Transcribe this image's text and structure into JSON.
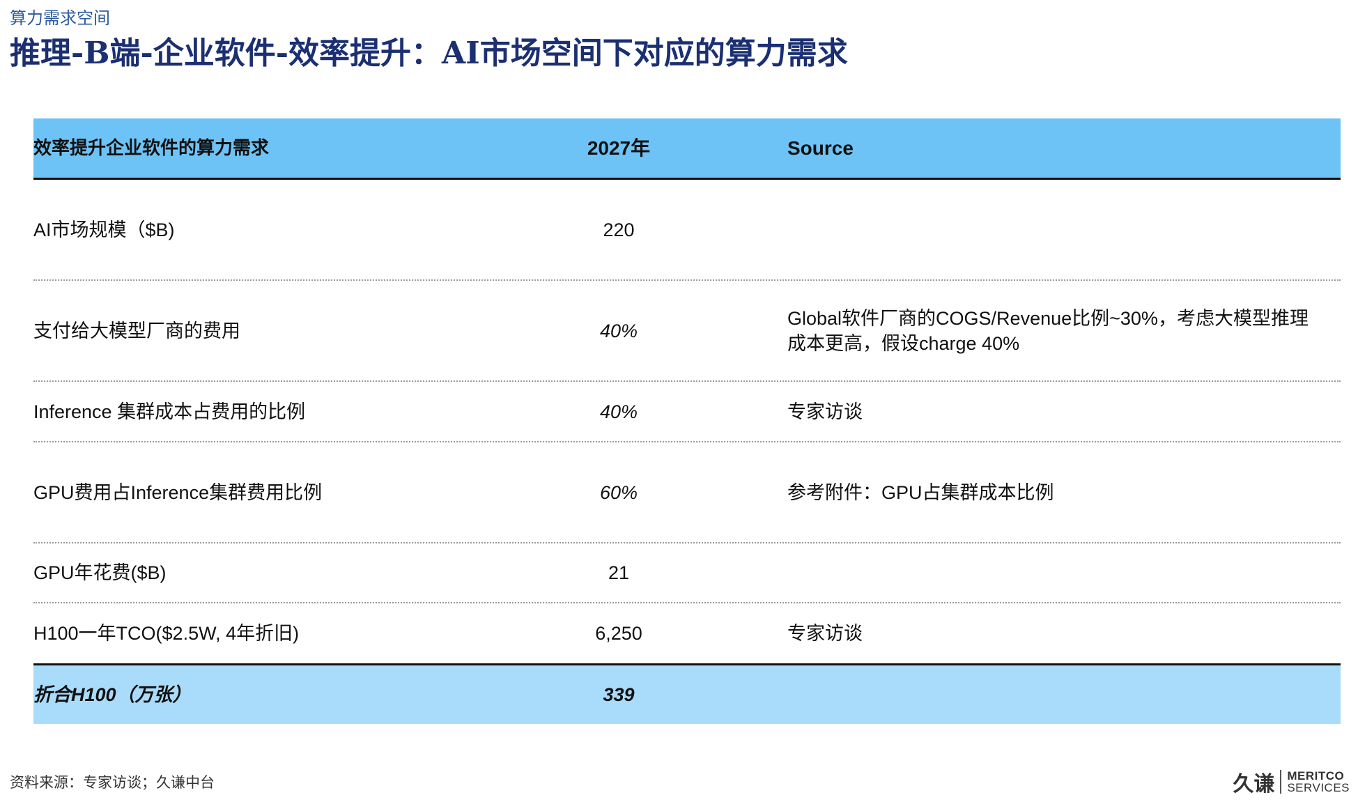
{
  "section_label": "算力需求空间",
  "title": "推理-B端-企业软件-效率提升：AI市场空间下对应的算力需求",
  "table": {
    "headers": [
      "效率提升企业软件的算力需求",
      "2027年",
      "Source"
    ],
    "rows": [
      {
        "label": "AI市场规模（$B)",
        "value": "220",
        "source": ""
      },
      {
        "label": "支付给大模型厂商的费用",
        "value": "40%",
        "source": "Global软件厂商的COGS/Revenue比例~30%，考虑大模型推理成本更高，假设charge 40%"
      },
      {
        "label": "Inference 集群成本占费用的比例",
        "value": "40%",
        "source": "专家访谈"
      },
      {
        "label": "GPU费用占Inference集群费用比例",
        "value": "60%",
        "source": "参考附件：GPU占集群成本比例"
      },
      {
        "label": "GPU年花费($B)",
        "value": "21",
        "source": ""
      },
      {
        "label": "H100一年TCO($2.5W, 4年折旧)",
        "value": "6,250",
        "source": "专家访谈"
      }
    ],
    "total": {
      "label": "折合H100（万张）",
      "value": "339",
      "source": ""
    }
  },
  "footer": {
    "source": "资料来源：专家访谈；久谦中台",
    "logo_cn": "久谦",
    "logo_en_line1": "MERITCO",
    "logo_en_line2": "SERVICES"
  },
  "colors": {
    "header_bg": "#6ec3f6",
    "total_bg": "#a9dcfa",
    "title": "#1b2f72"
  }
}
